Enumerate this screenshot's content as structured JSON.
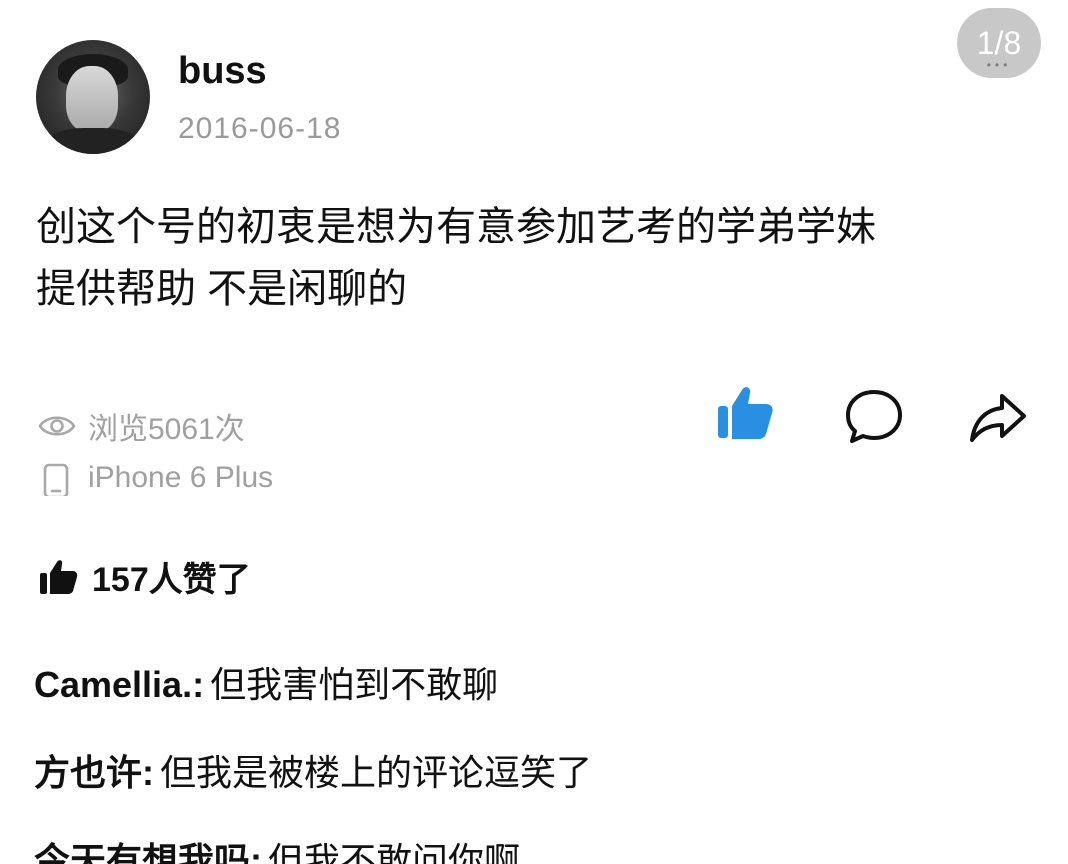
{
  "post": {
    "username": "buss",
    "date": "2016-06-18",
    "page_counter": "1/8",
    "body_line1": "创这个号的初衷是想为有意参加艺考的学弟学妹",
    "body_line2": "提供帮助 不是闲聊的",
    "views_text": "浏览5061次",
    "device_text": "iPhone 6 Plus",
    "likes_text": "157人赞了"
  },
  "comments": [
    {
      "author": "Camellia.:",
      "text": "但我害怕到不敢聊"
    },
    {
      "author": "方也许:",
      "text": "但我是被楼上的评论逗笑了"
    },
    {
      "author": "今天有想我吗:",
      "text": "但我不敢问你啊"
    }
  ],
  "icons": {
    "avatar": "user-avatar",
    "eye": "eye-icon",
    "phone": "phone-icon",
    "like": "thumbs-up-icon",
    "comment": "speech-bubble-icon",
    "share": "share-arrow-icon"
  },
  "colors": {
    "like_active": "#2a8fe0",
    "meta_gray": "#a0a0a0",
    "text": "#111111"
  }
}
